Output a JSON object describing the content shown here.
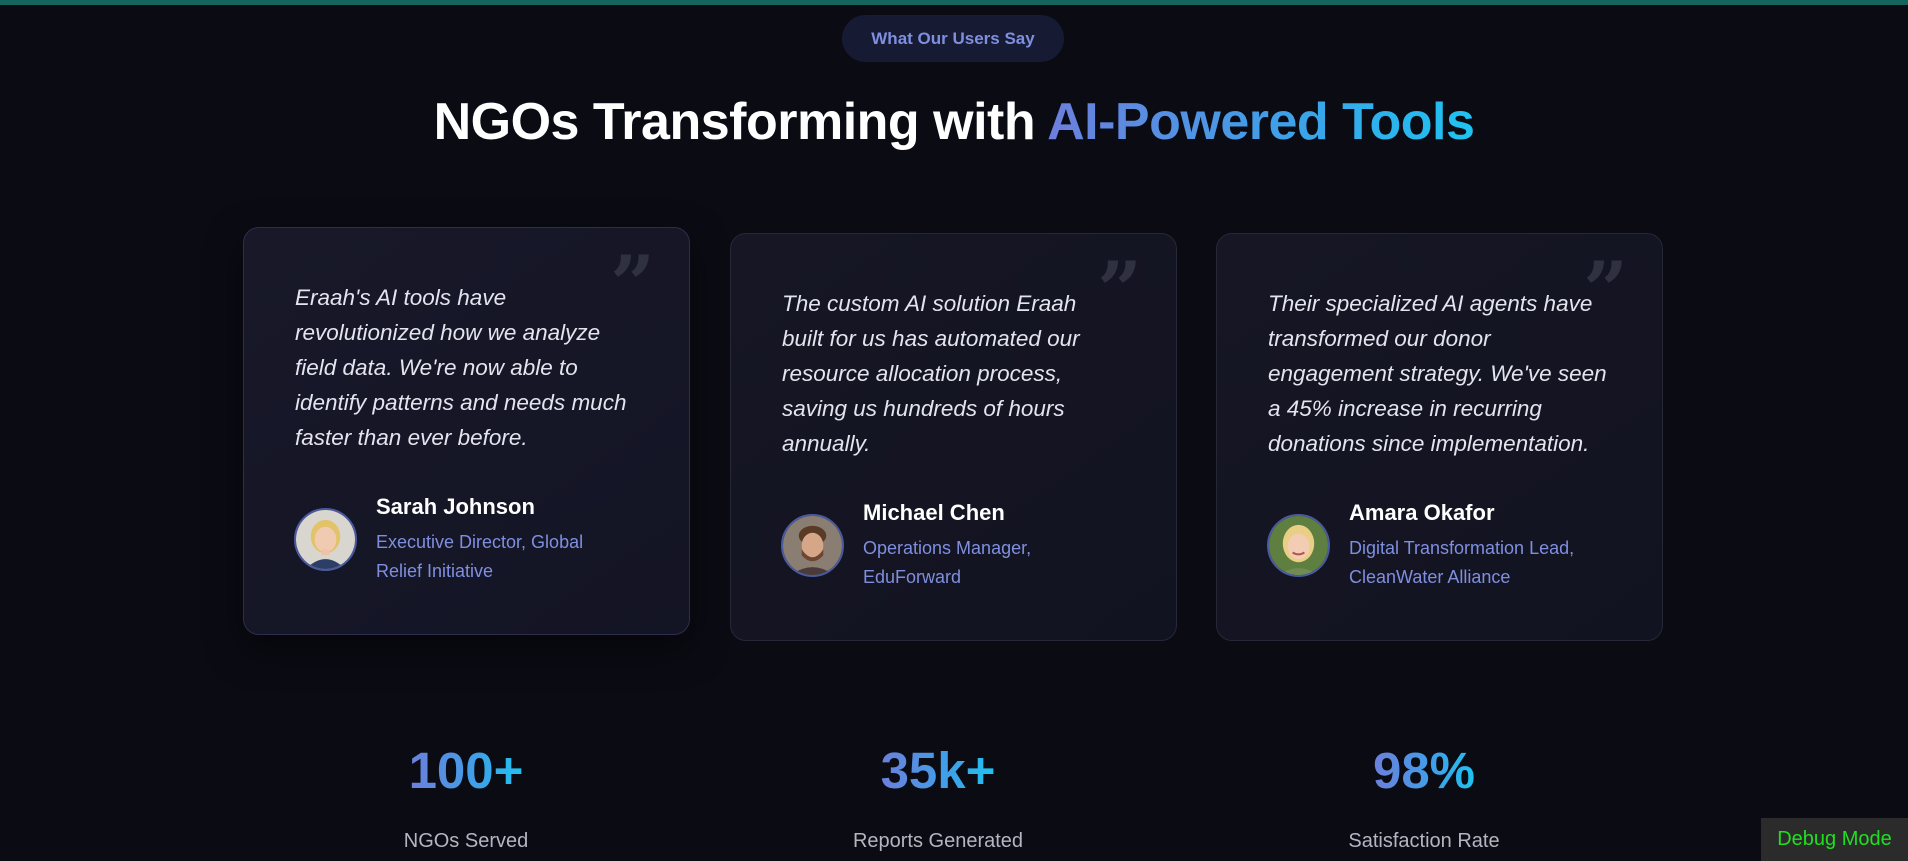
{
  "section": {
    "pill_label": "What Our Users Say",
    "headline_main": "NGOs Transforming with ",
    "headline_accent": "AI-Powered Tools",
    "quote_glyph": "”"
  },
  "testimonials": [
    {
      "quote": "Eraah's AI tools have revolutionized how we analyze field data. We're now able to identify patterns and needs much faster than ever before.",
      "name": "Sarah Johnson",
      "role": "Executive Director, Global Relief Initiative"
    },
    {
      "quote": "The custom AI solution Eraah built for us has automated our resource allocation process, saving us hundreds of hours annually.",
      "name": "Michael Chen",
      "role": "Operations Manager, EduForward"
    },
    {
      "quote": "Their specialized AI agents have transformed our donor engagement strategy. We've seen a 45% increase in recurring donations since implementation.",
      "name": "Amara Okafor",
      "role": "Digital Transformation Lead, CleanWater Alliance"
    }
  ],
  "stats": [
    {
      "value": "100+",
      "label": "NGOs Served"
    },
    {
      "value": "35k+",
      "label": "Reports Generated"
    },
    {
      "value": "98%",
      "label": "Satisfaction Rate"
    }
  ],
  "debug": {
    "label": "Debug Mode"
  },
  "colors": {
    "background": "#0b0b14",
    "top_bar": "#13655e",
    "accent_start": "#6c7fdc",
    "accent_end": "#1ec3f0",
    "role_text": "#7f8fe0",
    "debug_text": "#1fe01f"
  }
}
